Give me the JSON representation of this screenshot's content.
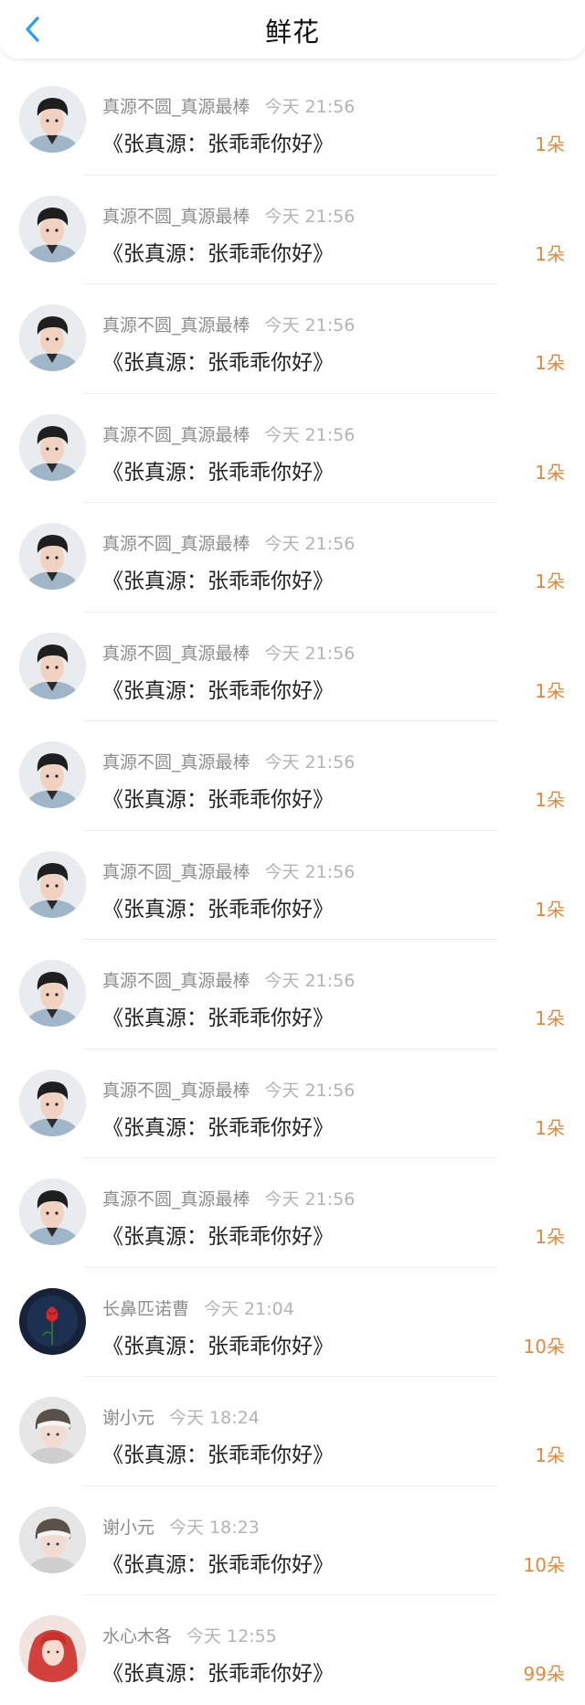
{
  "header": {
    "title": "鲜花",
    "back_icon": "chevron-left-icon",
    "accent": "#2a9df4"
  },
  "colors": {
    "count": "#df8a3c"
  },
  "items": [
    {
      "user": "真源不圆_真源最棒",
      "time": "今天 21:56",
      "message": "《张真源：张乖乖你好》",
      "count": "1朵",
      "avatar": "boy-portrait"
    },
    {
      "user": "真源不圆_真源最棒",
      "time": "今天 21:56",
      "message": "《张真源：张乖乖你好》",
      "count": "1朵",
      "avatar": "boy-portrait"
    },
    {
      "user": "真源不圆_真源最棒",
      "time": "今天 21:56",
      "message": "《张真源：张乖乖你好》",
      "count": "1朵",
      "avatar": "boy-portrait"
    },
    {
      "user": "真源不圆_真源最棒",
      "time": "今天 21:56",
      "message": "《张真源：张乖乖你好》",
      "count": "1朵",
      "avatar": "boy-portrait"
    },
    {
      "user": "真源不圆_真源最棒",
      "time": "今天 21:56",
      "message": "《张真源：张乖乖你好》",
      "count": "1朵",
      "avatar": "boy-portrait"
    },
    {
      "user": "真源不圆_真源最棒",
      "time": "今天 21:56",
      "message": "《张真源：张乖乖你好》",
      "count": "1朵",
      "avatar": "boy-portrait"
    },
    {
      "user": "真源不圆_真源最棒",
      "time": "今天 21:56",
      "message": "《张真源：张乖乖你好》",
      "count": "1朵",
      "avatar": "boy-portrait"
    },
    {
      "user": "真源不圆_真源最棒",
      "time": "今天 21:56",
      "message": "《张真源：张乖乖你好》",
      "count": "1朵",
      "avatar": "boy-portrait"
    },
    {
      "user": "真源不圆_真源最棒",
      "time": "今天 21:56",
      "message": "《张真源：张乖乖你好》",
      "count": "1朵",
      "avatar": "boy-portrait"
    },
    {
      "user": "真源不圆_真源最棒",
      "time": "今天 21:56",
      "message": "《张真源：张乖乖你好》",
      "count": "1朵",
      "avatar": "boy-portrait"
    },
    {
      "user": "真源不圆_真源最棒",
      "time": "今天 21:56",
      "message": "《张真源：张乖乖你好》",
      "count": "1朵",
      "avatar": "boy-portrait"
    },
    {
      "user": "长鼻匹诺曹",
      "time": "今天 21:04",
      "message": "《张真源：张乖乖你好》",
      "count": "10朵",
      "avatar": "rose-portrait"
    },
    {
      "user": "谢小元",
      "time": "今天 18:24",
      "message": "《张真源：张乖乖你好》",
      "count": "1朵",
      "avatar": "cap-portrait"
    },
    {
      "user": "谢小元",
      "time": "今天 18:23",
      "message": "《张真源：张乖乖你好》",
      "count": "10朵",
      "avatar": "cap-portrait"
    },
    {
      "user": "水心木各",
      "time": "今天 12:55",
      "message": "《张真源：张乖乖你好》",
      "count": "99朵",
      "avatar": "red-hair-portrait"
    }
  ]
}
